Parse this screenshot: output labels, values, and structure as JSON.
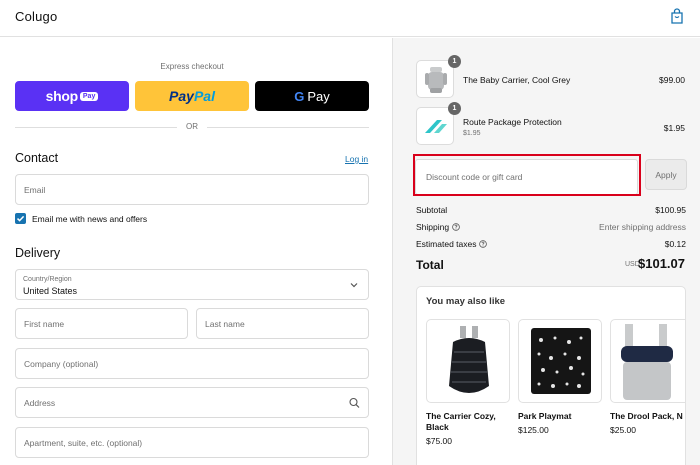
{
  "header": {
    "brand": "Colugo"
  },
  "express": {
    "title": "Express checkout",
    "shop_word": "shop",
    "shop_pay": "Pay",
    "paypal_pay": "Pay",
    "paypal_pal": "Pal",
    "gpay_g": "G",
    "gpay_word": "Pay",
    "or": "OR"
  },
  "contact": {
    "title": "Contact",
    "login": "Log in",
    "email_placeholder": "Email",
    "newsletter_label": "Email me with news and offers"
  },
  "delivery": {
    "title": "Delivery",
    "country_label": "Country/Region",
    "country_value": "United States",
    "first_name": "First name",
    "last_name": "Last name",
    "company": "Company (optional)",
    "address": "Address",
    "apartment": "Apartment, suite, etc. (optional)"
  },
  "order": {
    "items": [
      {
        "name": "The Baby Carrier, Cool Grey",
        "sub": "",
        "price": "$99.00",
        "qty": "1"
      },
      {
        "name": "Route Package Protection",
        "sub": "$1.95",
        "price": "$1.95",
        "qty": "1"
      }
    ],
    "discount_placeholder": "Discount code or gift card",
    "apply": "Apply",
    "subtotal_label": "Subtotal",
    "subtotal": "$100.95",
    "shipping_label": "Shipping",
    "shipping": "Enter shipping address",
    "taxes_label": "Estimated taxes",
    "taxes": "$0.12",
    "total_label": "Total",
    "total_currency": "USD",
    "total": "$101.07"
  },
  "upsell": {
    "title": "You may also like",
    "products": [
      {
        "name": "The Carrier Cozy, Black",
        "price": "$75.00"
      },
      {
        "name": "Park Playmat",
        "price": "$125.00"
      },
      {
        "name": "The Drool Pack, N",
        "price": "$25.00"
      }
    ]
  },
  "colors": {
    "shop_pay": "#5a31f4",
    "paypal": "#ffc439",
    "link": "#1773b0",
    "highlight": "#d9001b"
  }
}
